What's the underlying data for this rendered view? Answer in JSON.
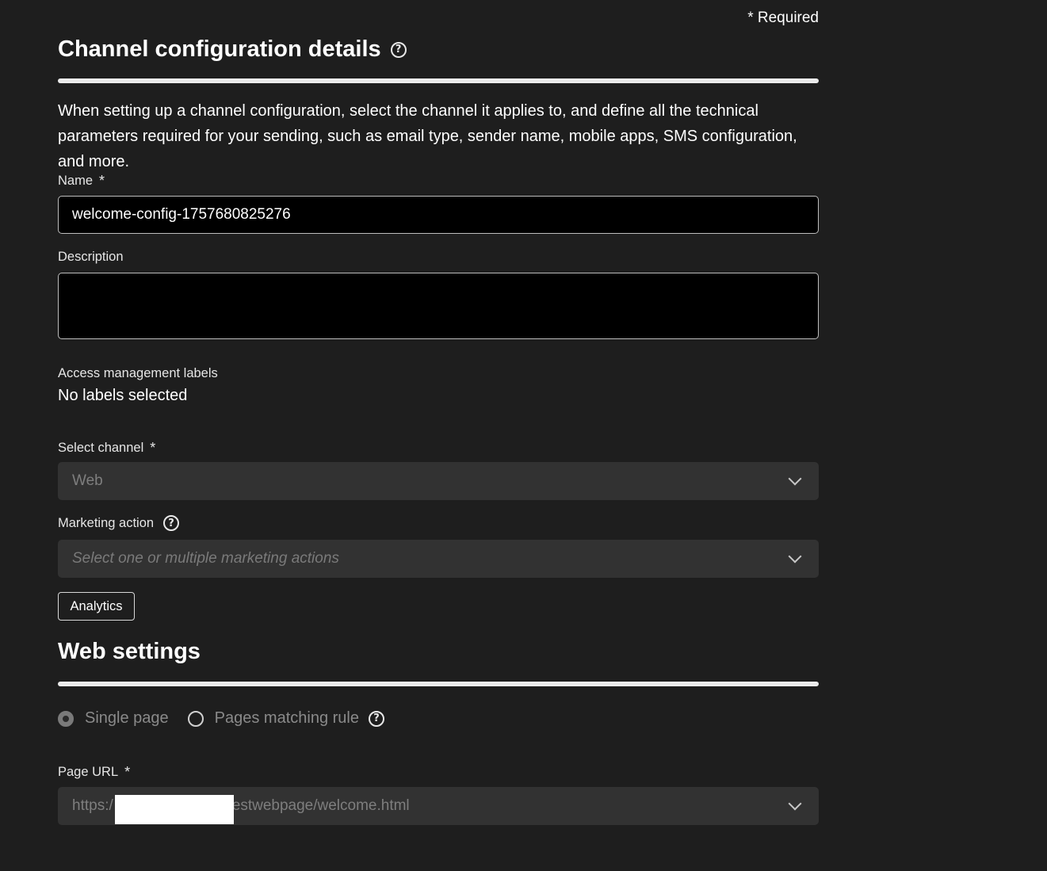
{
  "required_note": "* Required",
  "channel_section": {
    "title": "Channel configuration details",
    "help_icon": "help-circle-icon",
    "intro": "When setting up a channel configuration, select the channel it applies to, and define all the technical parameters required for your sending, such as email type, sender name, mobile apps, SMS configuration, and more."
  },
  "name_field": {
    "label": "Name",
    "asterisk": "*",
    "value": "welcome-config-1757680825276"
  },
  "description_field": {
    "label": "Description",
    "value": ""
  },
  "access_labels": {
    "label": "Access management labels",
    "value": "No labels selected"
  },
  "channel_select": {
    "label": "Select channel",
    "asterisk": "*",
    "value": "Web",
    "icon": "chevron-down-icon"
  },
  "marketing_action": {
    "label": "Marketing action",
    "help_icon": "help-circle-icon",
    "placeholder": "Select one or multiple marketing actions",
    "icon": "chevron-down-icon",
    "tags": [
      "Analytics"
    ]
  },
  "web_settings": {
    "title": "Web settings",
    "radio_options": [
      {
        "label": "Single page",
        "checked": true
      },
      {
        "label": "Pages matching rule",
        "checked": false
      }
    ],
    "help_icon": "help-circle-icon"
  },
  "page_url": {
    "label": "Page URL",
    "asterisk": "*",
    "value_prefix": "https:/",
    "value_suffix": "estwebpage/welcome.html",
    "icon": "chevron-down-icon"
  }
}
